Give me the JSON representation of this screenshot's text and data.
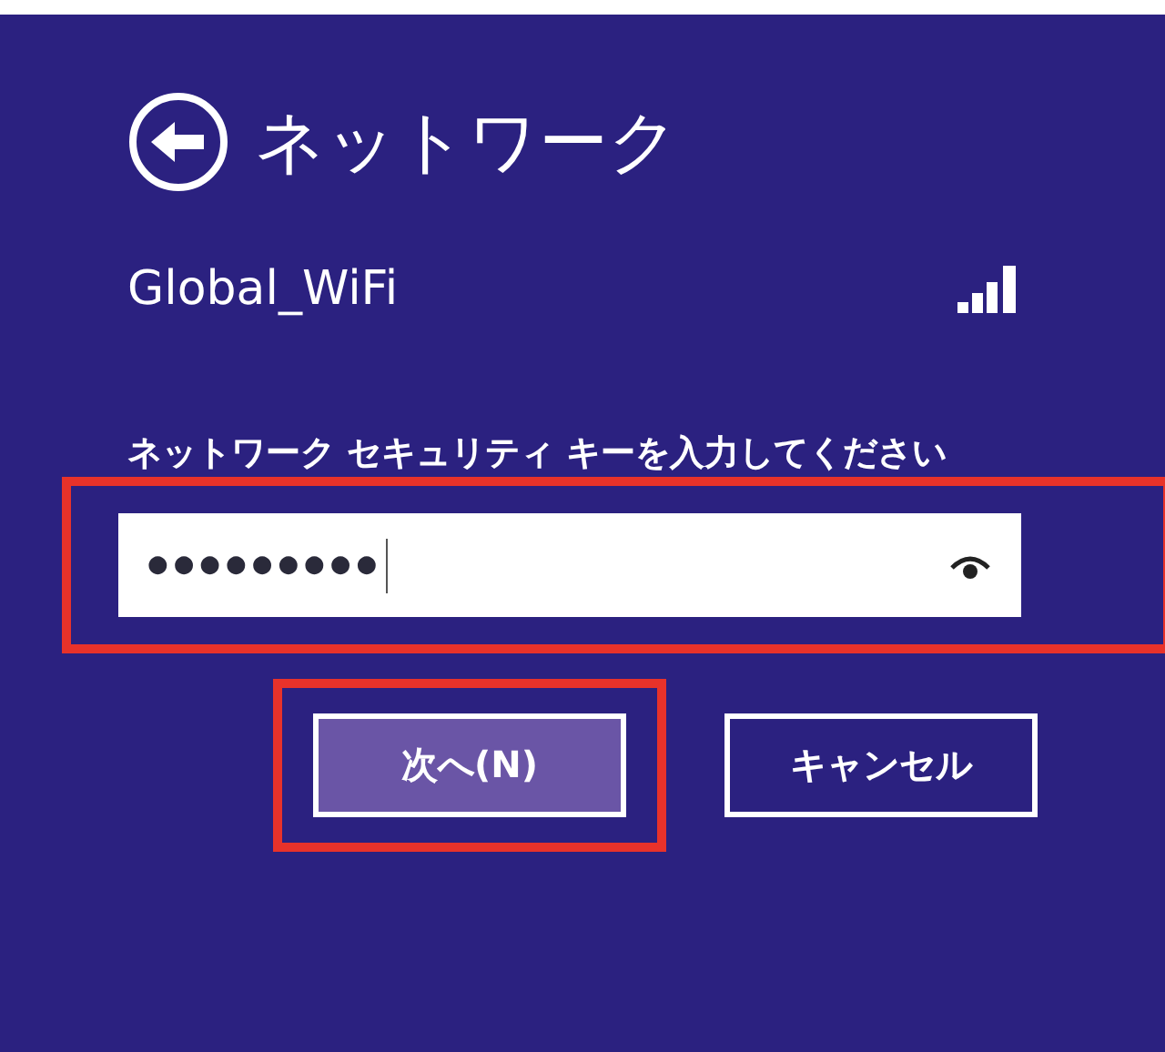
{
  "header": {
    "title": "ネットワーク"
  },
  "network": {
    "name": "Global_WiFi"
  },
  "key_prompt": {
    "label": "ネットワーク セキュリティ キーを入力してください",
    "value": "●●●●●●●●●",
    "highlighted": true
  },
  "buttons": [
    {
      "label": "次へ(N)",
      "kind": "primary",
      "highlighted": true
    },
    {
      "label": "キャンセル",
      "kind": "secondary",
      "highlighted": false
    }
  ]
}
